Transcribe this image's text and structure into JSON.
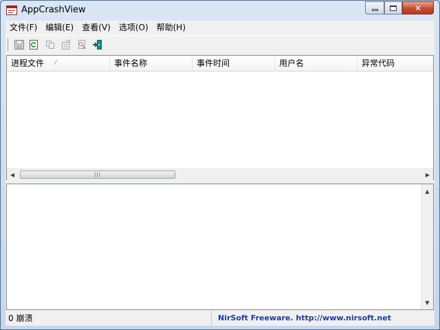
{
  "window": {
    "title": "AppCrashView",
    "icon": "appcrashview-app-icon",
    "caption_buttons": {
      "minimize": "minimize-icon",
      "maximize": "maximize-icon",
      "close": "✕"
    }
  },
  "menu": {
    "items": [
      {
        "label": "文件(F)"
      },
      {
        "label": "编辑(E)"
      },
      {
        "label": "查看(V)"
      },
      {
        "label": "选项(O)"
      },
      {
        "label": "帮助(H)"
      }
    ]
  },
  "toolbar": {
    "buttons": [
      {
        "icon": "save-icon",
        "enabled": false
      },
      {
        "icon": "refresh-icon",
        "enabled": true
      },
      {
        "icon": "copy-icon",
        "enabled": false
      },
      {
        "icon": "properties-icon",
        "enabled": false
      },
      {
        "icon": "find-icon",
        "enabled": false
      },
      {
        "icon": "exit-icon",
        "enabled": true
      }
    ]
  },
  "table": {
    "columns": [
      {
        "label": "进程文件",
        "sorted": true
      },
      {
        "label": "事件名称"
      },
      {
        "label": "事件时间"
      },
      {
        "label": "用户名"
      },
      {
        "label": "异常代码"
      }
    ],
    "sort_arrow": "⁄",
    "rows": []
  },
  "scrollbars": {
    "grip": "|||",
    "left_arrow": "◀",
    "right_arrow": "▶",
    "up_arrow": "▲",
    "down_arrow": "▼"
  },
  "status": {
    "count_text": "0 崩溃",
    "credit_text": "NirSoft Freeware.  http://www.nirsoft.net"
  },
  "colors": {
    "credit_link": "#1c3c9c",
    "close_button": "#c74a2f",
    "window_frame": "#c4d7ec"
  }
}
